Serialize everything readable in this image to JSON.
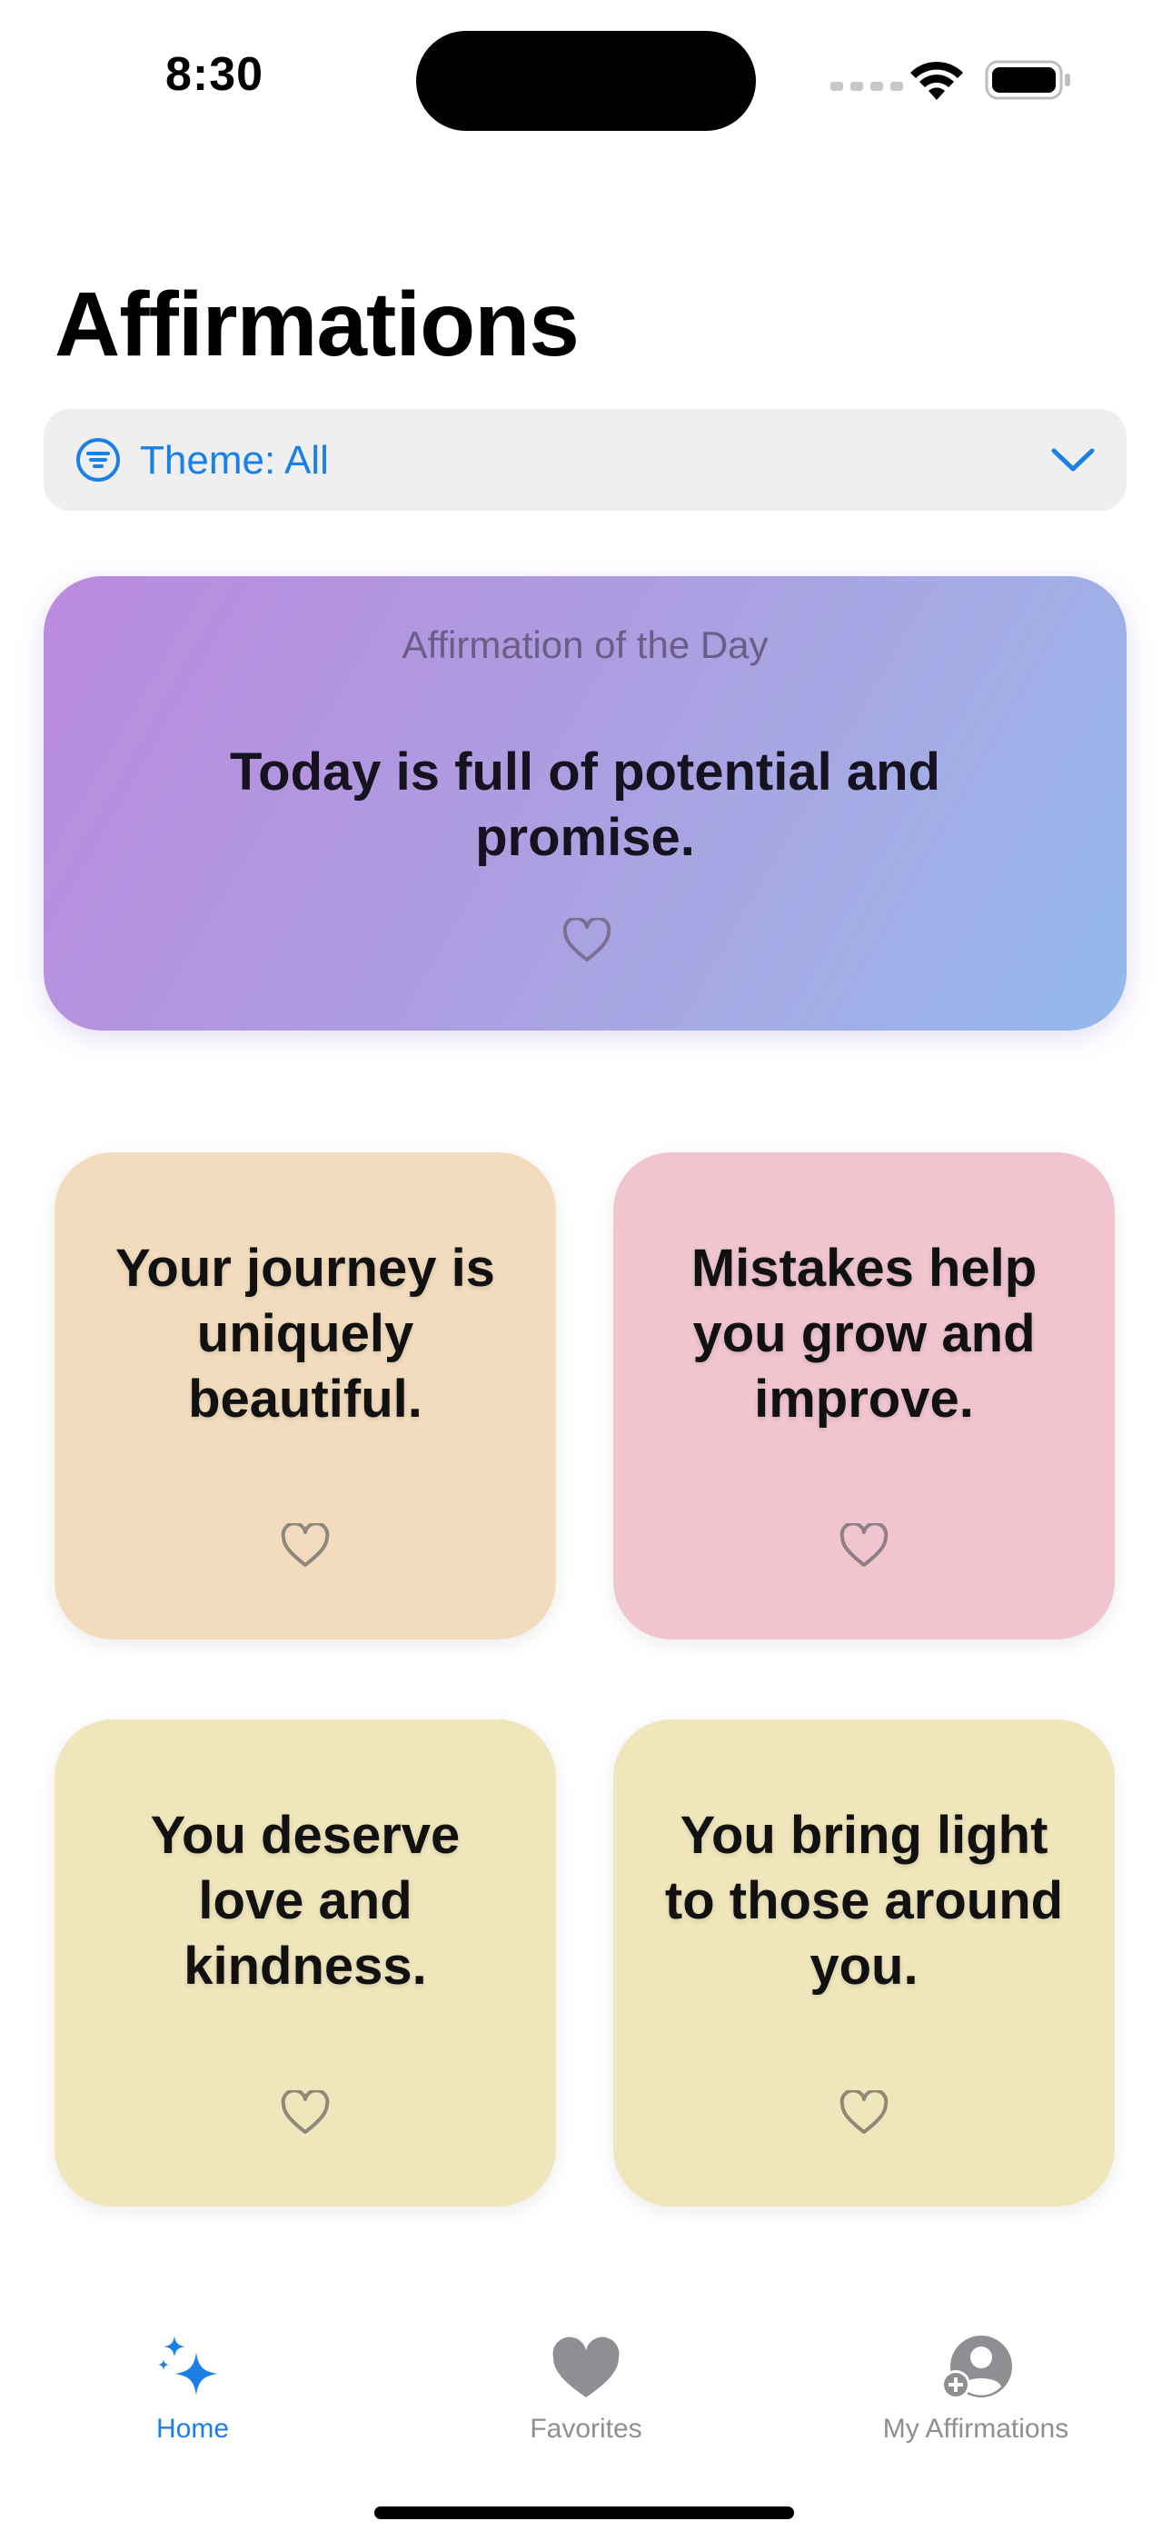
{
  "status_bar": {
    "time": "8:30"
  },
  "header": {
    "title": "Affirmations"
  },
  "theme_filter": {
    "label": "Theme: All"
  },
  "affirmation_of_the_day": {
    "kicker": "Affirmation of the Day",
    "text": "Today is full of potential and promise.",
    "colors": [
      "#bb8ade",
      "#92b9ec"
    ]
  },
  "affirmations": [
    {
      "text": "Your journey is uniquely beautiful.",
      "color": "#f3dcbd"
    },
    {
      "text": "Mistakes help you grow and improve.",
      "color": "#f0c5d0"
    },
    {
      "text": "You deserve love and kindness.",
      "color": "#f0e6bc"
    },
    {
      "text": "You bring light to those around you.",
      "color": "#f0e6bc"
    }
  ],
  "tab_bar": {
    "items": [
      {
        "label": "Home",
        "icon": "sparkles-icon",
        "active": true
      },
      {
        "label": "Favorites",
        "icon": "heart-fill-icon",
        "active": false
      },
      {
        "label": "My Affirmations",
        "icon": "person-add-icon",
        "active": false
      }
    ]
  },
  "colors": {
    "accent": "#1a7fe6",
    "inactive": "#8e8e93"
  }
}
